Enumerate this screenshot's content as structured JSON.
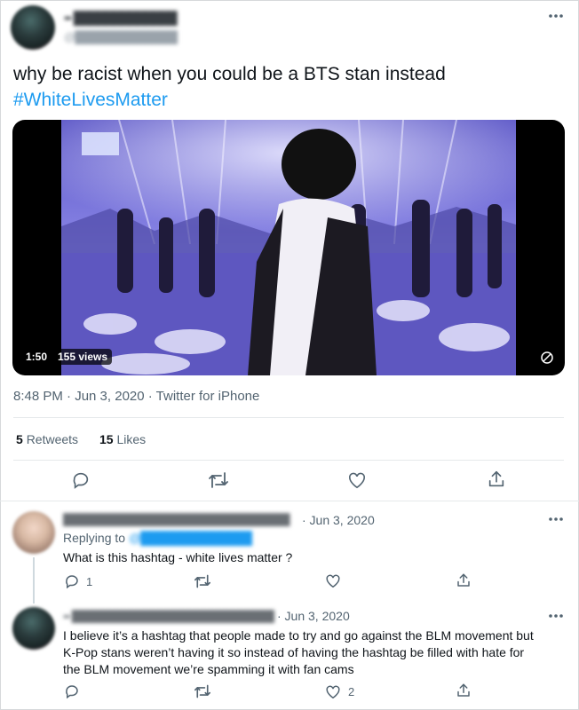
{
  "tweet": {
    "author_name": "•• █████████████",
    "author_handle": "@██████████████",
    "text": "why be racist when you could be a BTS stan instead",
    "hashtag": "#WhiteLivesMatter",
    "video": {
      "duration": "1:50",
      "views": "155 views"
    },
    "timestamp": "8:48 PM · Jun 3, 2020 · Twitter for iPhone",
    "retweets_count": "5",
    "retweets_label": "Retweets",
    "likes_count": "15",
    "likes_label": "Likes",
    "more_icon": "more-horizontal-icon"
  },
  "replies": [
    {
      "author_name": "███████████████████████████████",
      "date": "· Jun 3, 2020",
      "replying_label": "Replying to",
      "replying_handle": "@██████████████",
      "text": "What is this hashtag - white lives matter ?",
      "reply_count": "1",
      "like_count": ""
    },
    {
      "author_name": "•• ████████████████████████████",
      "date": "· Jun 3, 2020",
      "text_lines": [
        "I believe it’s a hashtag that people made to try and go against the BLM movement but",
        "K-Pop stans weren’t having it so instead of having the hashtag be filled with hate for",
        "the BLM movement we’re spamming it with fan cams"
      ],
      "reply_count": "",
      "like_count": "2"
    }
  ],
  "colors": {
    "accent": "#1d9bf0",
    "muted": "#536471",
    "text": "#0f1419",
    "border": "#e6e9eb"
  }
}
